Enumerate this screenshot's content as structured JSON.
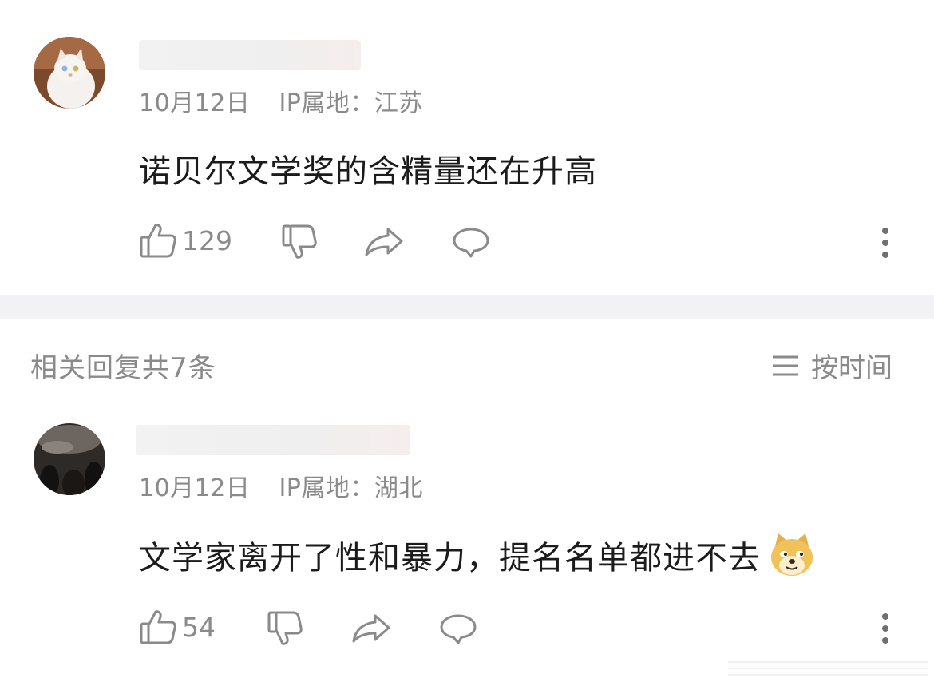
{
  "comment": {
    "date": "10月12日",
    "ip_label": "IP属地：江苏",
    "text": "诺贝尔文学奖的含精量还在升高",
    "like_count": "129"
  },
  "replies_header": {
    "title": "相关回复共7条",
    "sort_label": "按时间"
  },
  "reply": {
    "date": "10月12日",
    "ip_label": "IP属地：湖北",
    "text": "文学家离开了性和暴力，提名名单都进不去",
    "like_count": "54"
  },
  "icons": {
    "like": "thumb-up-icon",
    "dislike": "thumb-down-icon",
    "share": "share-arrow-icon",
    "reply": "comment-bubble-icon",
    "more": "more-vertical-icon",
    "sort": "list-lines-icon",
    "emoji": "doge-emoji"
  }
}
